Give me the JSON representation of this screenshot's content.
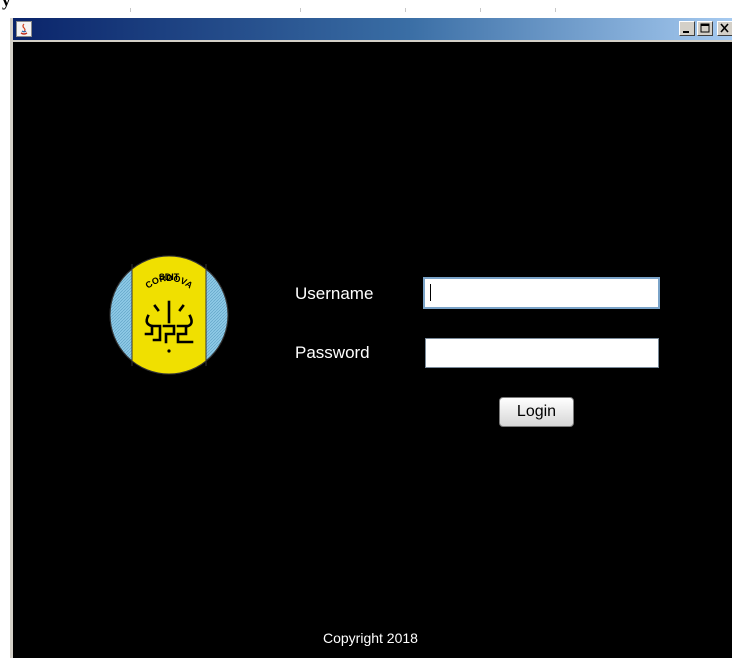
{
  "top_strip": {
    "text": "y"
  },
  "window": {
    "controls": {
      "minimize": "_",
      "maximize": "□",
      "close": "×"
    }
  },
  "logo": {
    "top_text": "SDIT",
    "arc_text": "CORDOVA",
    "colors": {
      "ring": "#8ec9e6",
      "band": "#f0e000"
    }
  },
  "form": {
    "username_label": "Username",
    "password_label": "Password",
    "username_value": "",
    "password_value": "",
    "login_label": "Login"
  },
  "footer": {
    "copyright": "Copyright 2018"
  }
}
